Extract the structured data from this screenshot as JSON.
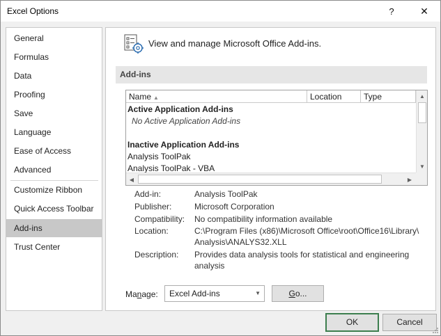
{
  "window": {
    "title": "Excel Options",
    "help_glyph": "?",
    "close_glyph": "✕"
  },
  "sidebar": {
    "items": [
      {
        "label": "General"
      },
      {
        "label": "Formulas"
      },
      {
        "label": "Data"
      },
      {
        "label": "Proofing"
      },
      {
        "label": "Save"
      },
      {
        "label": "Language"
      },
      {
        "label": "Ease of Access"
      },
      {
        "label": "Advanced"
      },
      {
        "label": "Customize Ribbon"
      },
      {
        "label": "Quick Access Toolbar"
      },
      {
        "label": "Add-ins",
        "selected": true
      },
      {
        "label": "Trust Center"
      }
    ]
  },
  "main": {
    "header_text": "View and manage Microsoft Office Add-ins.",
    "section_title": "Add-ins",
    "list": {
      "columns": [
        {
          "label": "Name"
        },
        {
          "label": "Location"
        },
        {
          "label": "Type"
        }
      ],
      "rows": [
        {
          "text": "Active Application Add-ins",
          "kind": "group"
        },
        {
          "text": "No Active Application Add-ins",
          "kind": "empty"
        },
        {
          "text": "",
          "kind": "spacer"
        },
        {
          "text": "Inactive Application Add-ins",
          "kind": "group"
        },
        {
          "text": "Analysis ToolPak",
          "kind": "item"
        },
        {
          "text": "Analysis ToolPak - VBA",
          "kind": "item"
        }
      ]
    },
    "details": {
      "addin": {
        "label": "Add-in:",
        "value": "Analysis ToolPak"
      },
      "publisher": {
        "label": "Publisher:",
        "value": "Microsoft Corporation"
      },
      "compatibility": {
        "label": "Compatibility:",
        "value": "No compatibility information available"
      },
      "location": {
        "label": "Location:",
        "value_line1": "C:\\Program Files (x86)\\Microsoft Office\\root\\Office16\\Library\\",
        "value_line2": "Analysis\\ANALYS32.XLL"
      },
      "description": {
        "label": "Description:",
        "value_line1": "Provides data analysis tools for statistical and engineering",
        "value_line2": "analysis"
      }
    },
    "manage": {
      "label_pre": "Ma",
      "label_underlined": "n",
      "label_post": "age:",
      "selected": "Excel Add-ins",
      "go_underlined": "G",
      "go_rest": "o..."
    }
  },
  "footer": {
    "ok_label": "OK",
    "cancel_label": "Cancel"
  },
  "colors": {
    "selected_nav": "#c8c8c8",
    "ok_border": "#3c7e4e",
    "section_bg": "#e6e6e6"
  }
}
